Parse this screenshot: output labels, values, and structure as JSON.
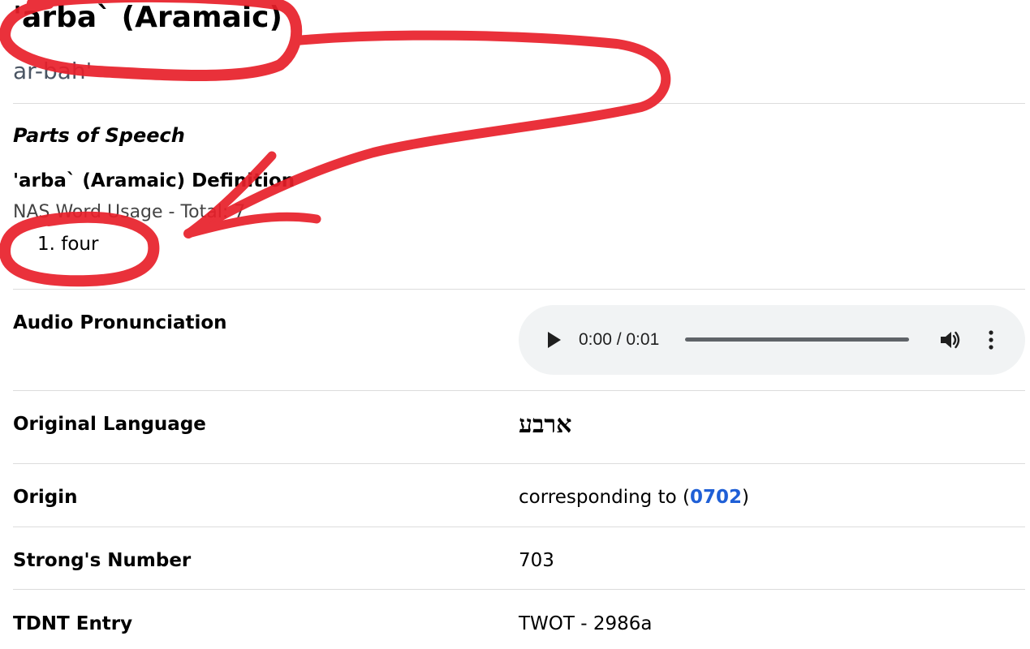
{
  "entry": {
    "title": "'arba` (Aramaic)",
    "pronunciation": "ar-bah'"
  },
  "parts_of_speech_label": "Parts of Speech",
  "definition": {
    "title": "'arba` (Aramaic) Definition",
    "usage": "NAS Word Usage - Total: 7",
    "items": [
      "1. four"
    ]
  },
  "audio": {
    "label": "Audio Pronunciation",
    "time": "0:00 / 0:01",
    "progress": 0,
    "icons": [
      "play-icon",
      "volume-icon",
      "more-options-icon"
    ]
  },
  "rows": {
    "original_language": {
      "label": "Original Language",
      "value": "ארבע"
    },
    "origin": {
      "label": "Origin",
      "prefix": "corresponding to (",
      "link": "0702",
      "suffix": ")"
    },
    "strongs": {
      "label": "Strong's Number",
      "value": "703"
    },
    "tdnt": {
      "label": "TDNT Entry",
      "value": "TWOT - 2986a"
    }
  },
  "colors": {
    "link": "#1f5fd6",
    "annotation": "#e8202a",
    "player_bg": "#f1f3f4"
  }
}
